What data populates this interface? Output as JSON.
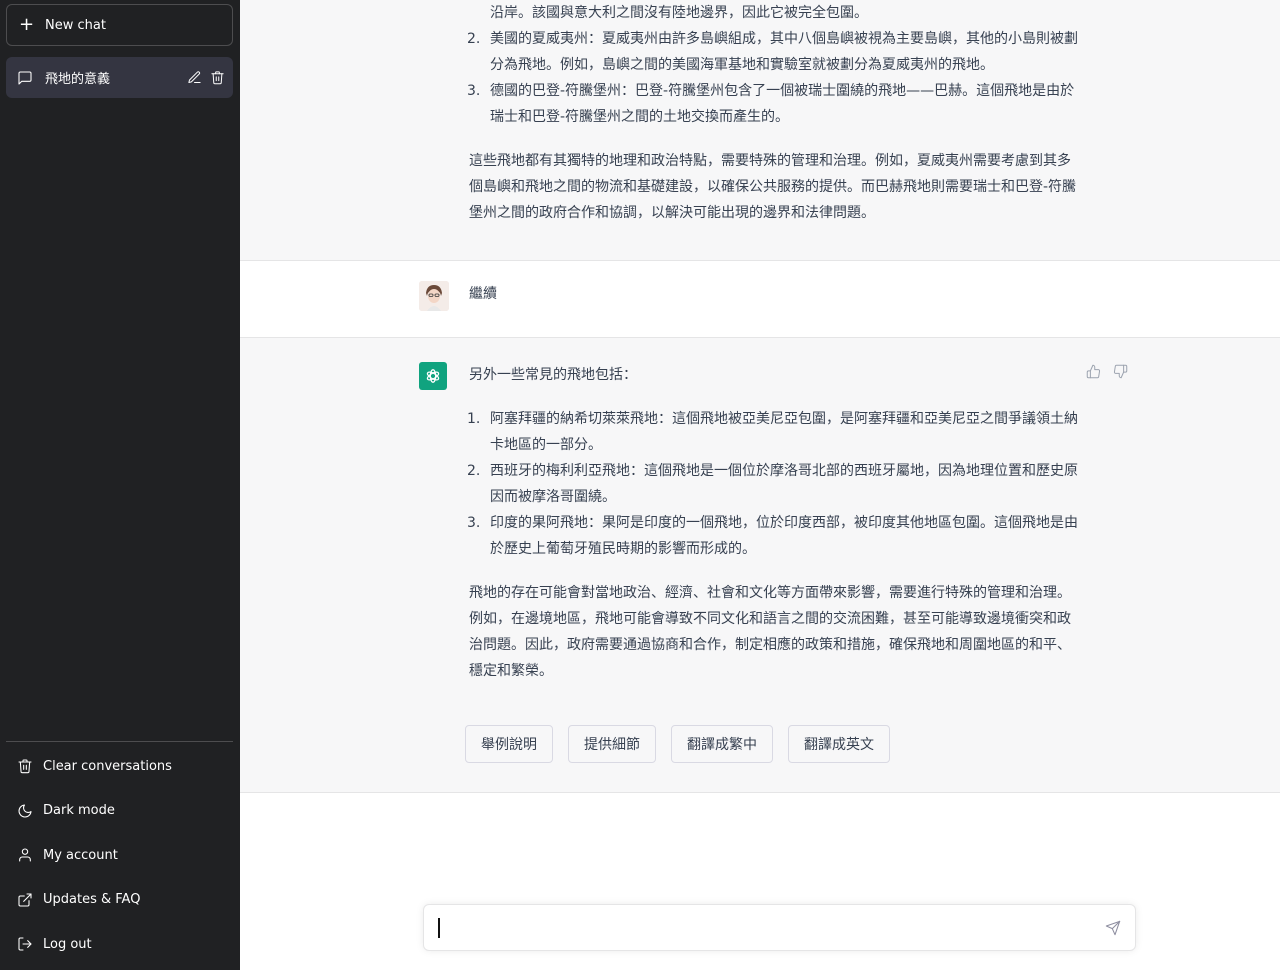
{
  "sidebar": {
    "new_chat": "New chat",
    "conversations": [
      {
        "title": "飛地的意義"
      }
    ],
    "menu": [
      {
        "label": "Clear conversations",
        "icon": "trash-icon"
      },
      {
        "label": "Dark mode",
        "icon": "moon-icon"
      },
      {
        "label": "My account",
        "icon": "user-icon"
      },
      {
        "label": "Updates & FAQ",
        "icon": "external-link-icon"
      },
      {
        "label": "Log out",
        "icon": "logout-icon"
      }
    ]
  },
  "messages": [
    {
      "role": "assistant",
      "lead": "沿岸。該國與意大利之間沒有陸地邊界，因此它被完全包圍。",
      "items": [
        {
          "num": "2.",
          "text": "美國的夏威夷州：夏威夷州由許多島嶼組成，其中八個島嶼被視為主要島嶼，其他的小島則被劃分為飛地。例如，島嶼之間的美國海軍基地和實驗室就被劃分為夏威夷州的飛地。"
        },
        {
          "num": "3.",
          "text": "德國的巴登-符騰堡州：巴登-符騰堡州包含了一個被瑞士圍繞的飛地——巴赫。這個飛地是由於瑞士和巴登-符騰堡州之間的土地交換而產生的。"
        }
      ],
      "paragraph": "這些飛地都有其獨特的地理和政治特點，需要特殊的管理和治理。例如，夏威夷州需要考慮到其多個島嶼和飛地之間的物流和基礎建設，以確保公共服務的提供。而巴赫飛地則需要瑞士和巴登-符騰堡州之間的政府合作和協調，以解決可能出現的邊界和法律問題。"
    },
    {
      "role": "user",
      "text": "繼續"
    },
    {
      "role": "assistant",
      "intro": "另外一些常見的飛地包括：",
      "items": [
        {
          "num": "1.",
          "text": "阿塞拜疆的納希切萊萊飛地：這個飛地被亞美尼亞包圍，是阿塞拜疆和亞美尼亞之間爭議領土納卡地區的一部分。"
        },
        {
          "num": "2.",
          "text": "西班牙的梅利利亞飛地：這個飛地是一個位於摩洛哥北部的西班牙屬地，因為地理位置和歷史原因而被摩洛哥圍繞。"
        },
        {
          "num": "3.",
          "text": "印度的果阿飛地：果阿是印度的一個飛地，位於印度西部，被印度其他地區包圍。這個飛地是由於歷史上葡萄牙殖民時期的影響而形成的。"
        }
      ],
      "paragraph": "飛地的存在可能會對當地政治、經濟、社會和文化等方面帶來影響，需要進行特殊的管理和治理。例如，在邊境地區，飛地可能會導致不同文化和語言之間的交流困難，甚至可能導致邊境衝突和政治問題。因此，政府需要通過協商和合作，制定相應的政策和措施，確保飛地和周圍地區的和平、穩定和繁榮。"
    }
  ],
  "suggestions": [
    "舉例說明",
    "提供細節",
    "翻譯成繁中",
    "翻譯成英文"
  ],
  "composer": {
    "value": "",
    "placeholder": ""
  },
  "colors": {
    "sidebar_bg": "#202123",
    "active_item_bg": "#343541",
    "assistant_bg": "#f7f7f8",
    "brand_green": "#10a37f"
  }
}
